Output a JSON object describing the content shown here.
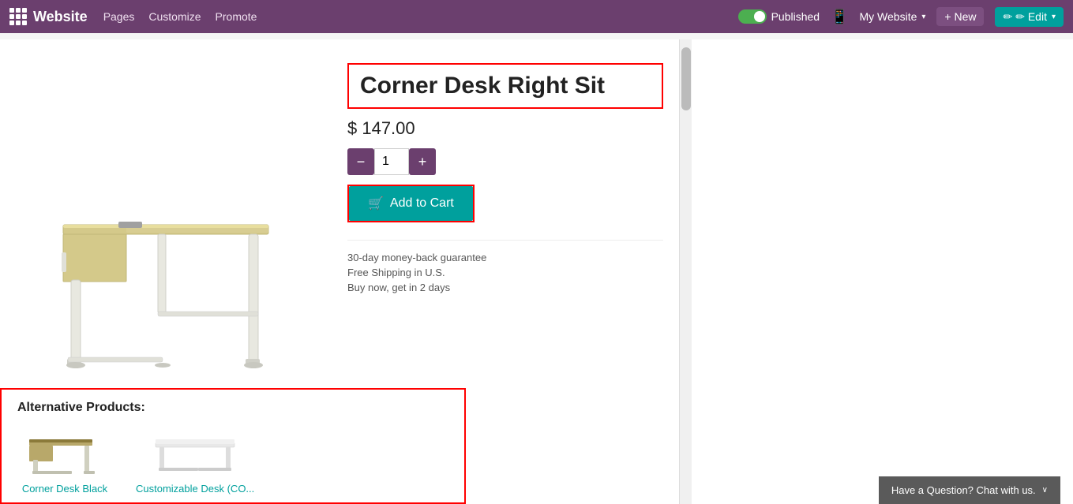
{
  "navbar": {
    "brand": "Website",
    "links": [
      "Pages",
      "Customize",
      "Promote"
    ],
    "published_label": "Published",
    "toggle_on": true,
    "mobile_icon": "📱",
    "my_website_label": "My Website",
    "new_label": "+ New",
    "edit_label": "✏ Edit"
  },
  "product": {
    "title": "Corner Desk Right Sit",
    "price": "$ 147.00",
    "quantity": 1,
    "add_to_cart_label": "Add to Cart",
    "guarantees": [
      "30-day money-back guarantee",
      "Free Shipping in U.S.",
      "Buy now, get in 2 days"
    ]
  },
  "alternative_products": {
    "section_title": "Alternative Products:",
    "items": [
      {
        "name": "Corner Desk Black"
      },
      {
        "name": "Customizable Desk (CO..."
      }
    ]
  },
  "chat_widget": {
    "label": "Have a Question? Chat with us.",
    "collapse_icon": "∨"
  }
}
